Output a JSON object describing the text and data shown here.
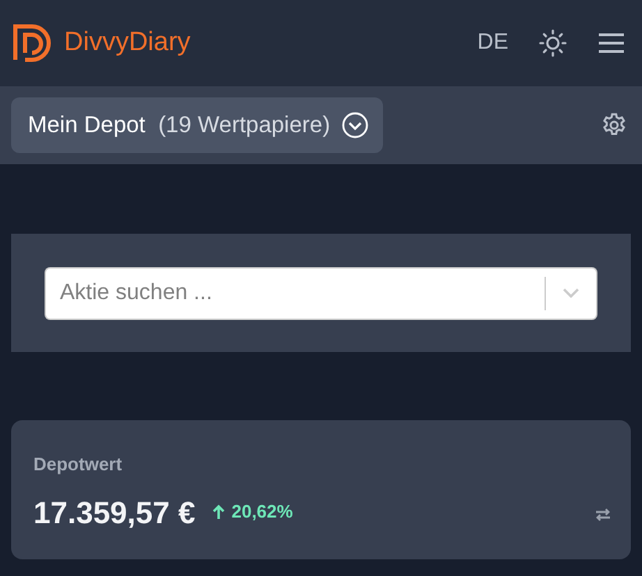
{
  "header": {
    "logo_text": "DivvyDiary",
    "language": "DE"
  },
  "depot": {
    "name": "Mein Depot",
    "count": "(19 Wertpapiere)"
  },
  "search": {
    "placeholder": "Aktie suchen ..."
  },
  "value_card": {
    "label": "Depotwert",
    "value": "17.359,57 €",
    "change": "20,62%",
    "positive": true
  }
}
